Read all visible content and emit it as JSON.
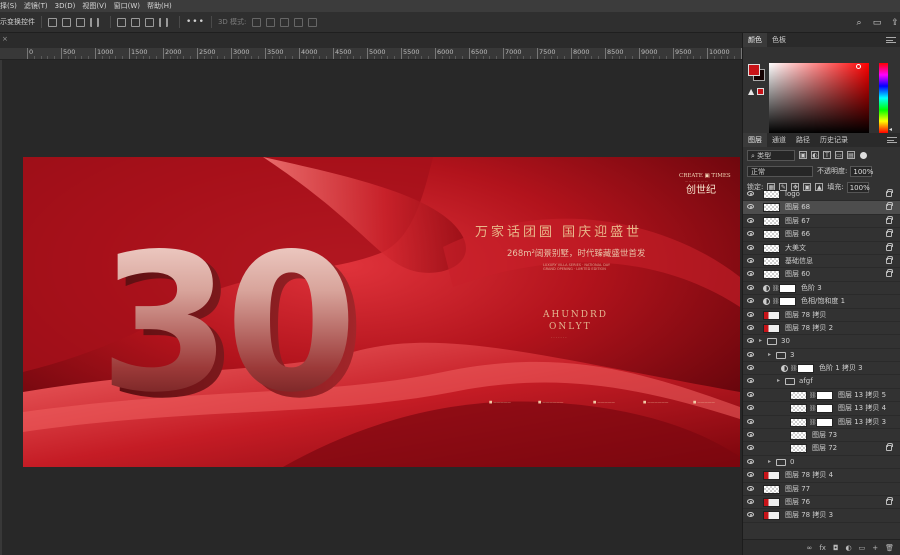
{
  "menu": [
    "择(S)",
    "滤镜(T)",
    "3D(D)",
    "视图(V)",
    "窗口(W)",
    "帮助(H)"
  ],
  "options_bar": {
    "show_transform_controls": "示变换控件",
    "more_label": "•••",
    "mode_3d": "3D 模式:"
  },
  "ruler_ticks": [
    "0",
    "500",
    "1000",
    "1500",
    "2000",
    "2500",
    "3000",
    "3500",
    "4000",
    "4500",
    "5000",
    "5500",
    "6000",
    "6500",
    "7000",
    "7500",
    "8000",
    "8500",
    "9000",
    "9500",
    "10000",
    "105"
  ],
  "artwork": {
    "big_number": "30",
    "headline": "万家话团圆  国庆迎盛世",
    "subline": "268m²阔景别墅，时代臻藏盛世首发",
    "tiny_lines": [
      "LUXURY VILLA SERIES · NATIONAL DAY",
      "GRAND OPENING · LIMITED EDITION"
    ],
    "brand_en": "CREATE ▣ TIMES",
    "brand_tag": "— — — — — —",
    "brand_cn": "创世纪",
    "center_en_1": "AHUNDRD",
    "center_en_2": "ONLYT",
    "center_small": "- - - -  - - -",
    "footer_items": [
      "■ —————",
      "■ ——————",
      "■ —————",
      "■ ——————",
      "■ —————"
    ]
  },
  "panels": {
    "color_tabs": [
      "颜色",
      "色板"
    ],
    "layer_tabs": [
      "图层",
      "通道",
      "路径",
      "历史记录"
    ],
    "filter_kind": "类型",
    "blend_mode": "正常",
    "opacity_label": "不透明度:",
    "opacity_value": "100%",
    "lock_label": "锁定:",
    "fill_label": "填充:",
    "fill_value": "100%",
    "fg_color": "#c81318",
    "bg_color": "#140000"
  },
  "layers": [
    {
      "name": "logo",
      "indent": 0,
      "kind": "thumb",
      "lock": true
    },
    {
      "name": "图层 68",
      "indent": 0,
      "kind": "thumb",
      "lock": true,
      "selected": true
    },
    {
      "name": "图层 67",
      "indent": 0,
      "kind": "thumb",
      "lock": true
    },
    {
      "name": "图层 66",
      "indent": 0,
      "kind": "thumb",
      "lock": true
    },
    {
      "name": "大美文",
      "indent": 0,
      "kind": "thumb",
      "lock": true
    },
    {
      "name": "基础信息",
      "indent": 0,
      "kind": "thumb",
      "lock": true
    },
    {
      "name": "图层 60",
      "indent": 0,
      "kind": "thumb",
      "lock": true
    },
    {
      "name": "色阶 3",
      "indent": 0,
      "kind": "adj",
      "lock": false
    },
    {
      "name": "色相/饱和度 1",
      "indent": 0,
      "kind": "adj",
      "lock": false
    },
    {
      "name": "图层 78 拷贝",
      "indent": 0,
      "kind": "red",
      "lock": false
    },
    {
      "name": "图层 78 拷贝 2",
      "indent": 0,
      "kind": "red",
      "lock": false
    },
    {
      "name": "30",
      "indent": 0,
      "kind": "folder",
      "lock": false
    },
    {
      "name": "3",
      "indent": 1,
      "kind": "folder",
      "lock": false
    },
    {
      "name": "色阶 1 拷贝 3",
      "indent": 2,
      "kind": "adj",
      "lock": false
    },
    {
      "name": "afgf",
      "indent": 2,
      "kind": "folder",
      "lock": false
    },
    {
      "name": "图层 13 拷贝 5",
      "indent": 3,
      "kind": "thumbmask",
      "lock": false
    },
    {
      "name": "图层 13 拷贝 4",
      "indent": 3,
      "kind": "thumbmask",
      "lock": false
    },
    {
      "name": "图层 13 拷贝 3",
      "indent": 3,
      "kind": "thumbmask",
      "lock": false
    },
    {
      "name": "图层 73",
      "indent": 3,
      "kind": "thumb",
      "lock": false
    },
    {
      "name": "图层 72",
      "indent": 3,
      "kind": "thumb",
      "lock": true
    },
    {
      "name": "0",
      "indent": 1,
      "kind": "folder",
      "lock": false
    },
    {
      "name": "图层 78 拷贝 4",
      "indent": 0,
      "kind": "red",
      "lock": false
    },
    {
      "name": "图层 77",
      "indent": 0,
      "kind": "thumb",
      "lock": false
    },
    {
      "name": "图层 76",
      "indent": 0,
      "kind": "red",
      "lock": true
    },
    {
      "name": "图层 78 拷贝 3",
      "indent": 0,
      "kind": "red",
      "lock": false
    }
  ],
  "bottom_icons": [
    "∞",
    "fx",
    "◘",
    "◐",
    "▭",
    "+",
    "🗑"
  ]
}
